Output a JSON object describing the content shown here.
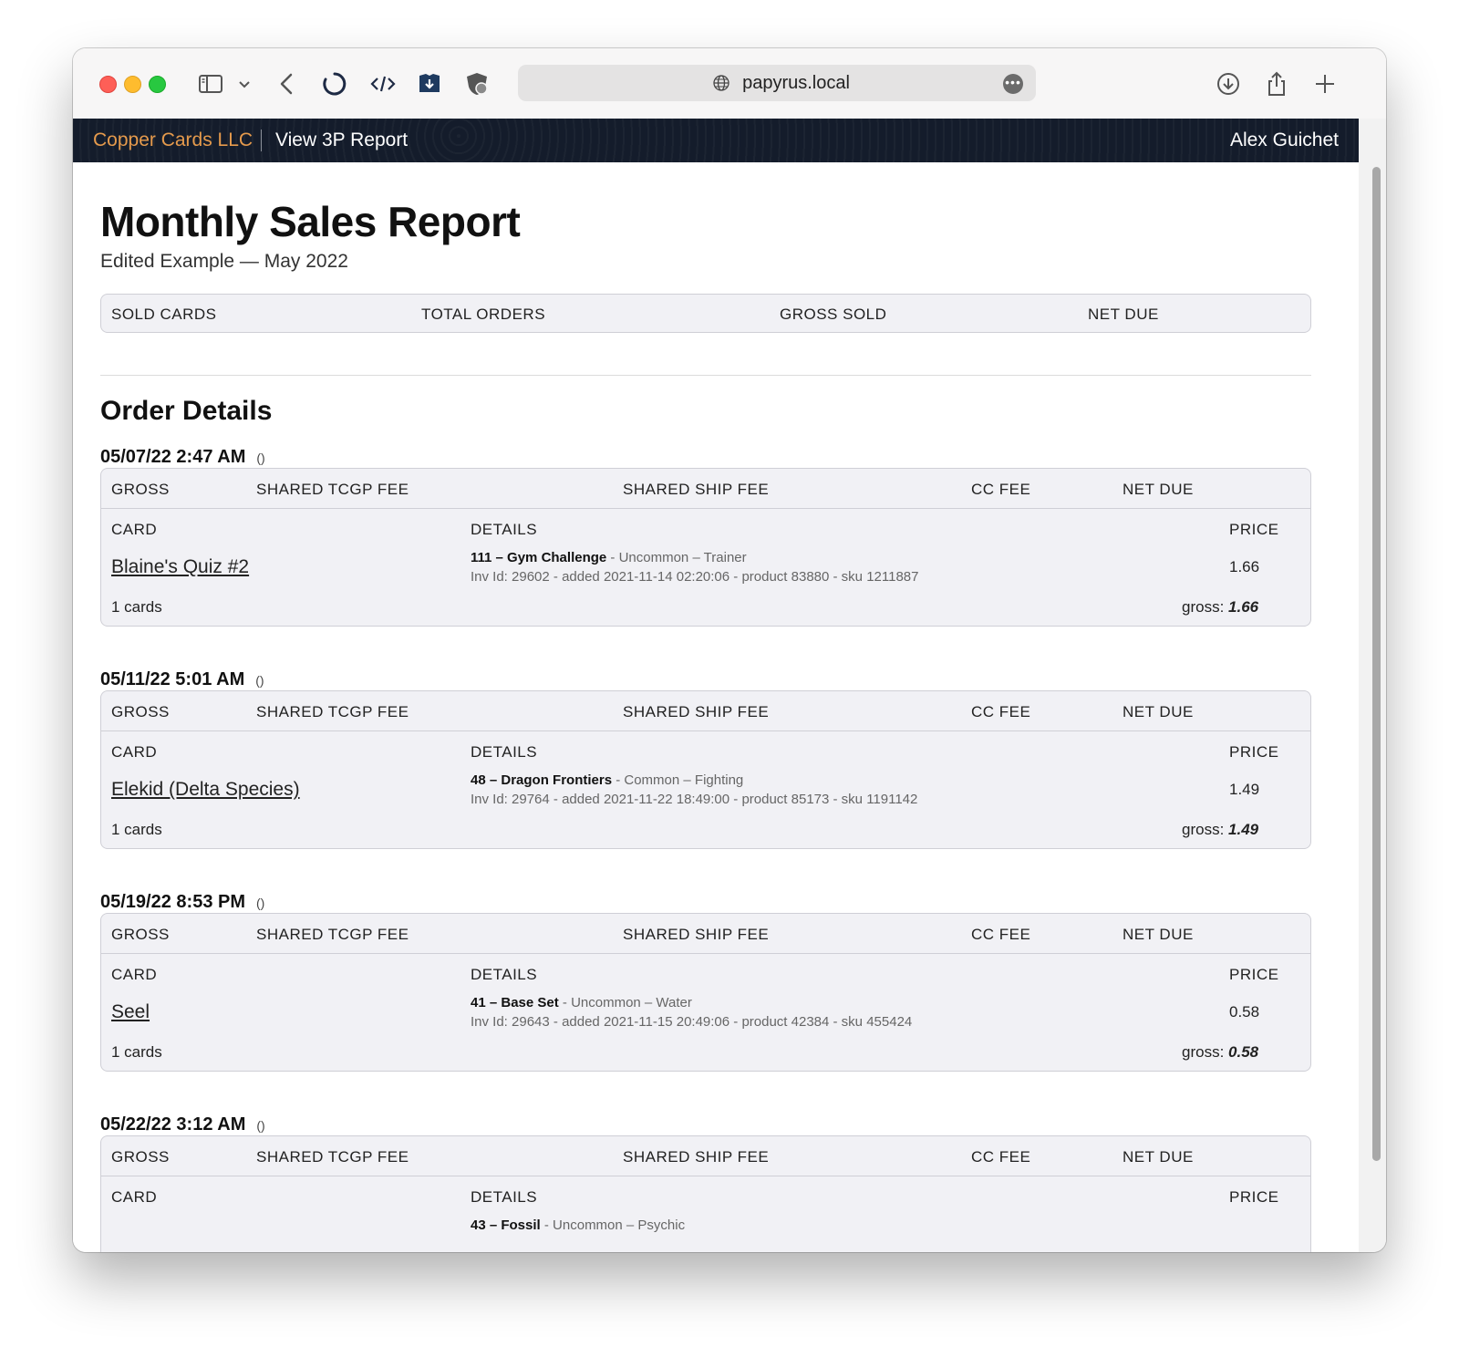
{
  "browser": {
    "url": "papyrus.local"
  },
  "header": {
    "brand": "Copper Cards LLC",
    "page": "View 3P Report",
    "user": "Alex Guichet"
  },
  "report": {
    "title": "Monthly Sales Report",
    "subtitle": "Edited Example — May 2022",
    "summary_labels": [
      "SOLD CARDS",
      "TOTAL ORDERS",
      "GROSS SOLD",
      "NET DUE"
    ]
  },
  "orders_section": {
    "title": "Order Details",
    "fee_labels": {
      "gross": "GROSS",
      "tcgp": "SHARED TCGP FEE",
      "ship": "SHARED SHIP FEE",
      "cc": "CC FEE",
      "net": "NET DUE"
    },
    "item_labels": {
      "card": "CARD",
      "details": "DETAILS",
      "price": "PRICE"
    },
    "gross_prefix": "gross:"
  },
  "orders": [
    {
      "date": "05/07/22 2:47 AM",
      "paren": "()",
      "card": "Blaine's Quiz #2",
      "number_set": "111 – Gym Challenge",
      "rarity_type": " - Uncommon – Trainer",
      "inventory": "Inv Id: 29602 - added 2021-11-14 02:20:06 - product 83880 - sku 1211887",
      "price": "1.66",
      "count": "1 cards",
      "gross": "1.66"
    },
    {
      "date": "05/11/22 5:01 AM",
      "paren": "()",
      "card": "Elekid (Delta Species)",
      "number_set": "48 – Dragon Frontiers",
      "rarity_type": " - Common – Fighting",
      "inventory": "Inv Id: 29764 - added 2021-11-22 18:49:00 - product 85173 - sku 1191142",
      "price": "1.49",
      "count": "1 cards",
      "gross": "1.49"
    },
    {
      "date": "05/19/22 8:53 PM",
      "paren": "()",
      "card": "Seel",
      "number_set": "41 – Base Set",
      "rarity_type": " - Uncommon – Water",
      "inventory": "Inv Id: 29643 - added 2021-11-15 20:49:06 - product 42384 - sku 455424",
      "price": "0.58",
      "count": "1 cards",
      "gross": "0.58"
    },
    {
      "date": "05/22/22 3:12 AM",
      "paren": "()",
      "number_set": "43 – Fossil",
      "rarity_type": " - Uncommon – Psychic"
    }
  ]
}
